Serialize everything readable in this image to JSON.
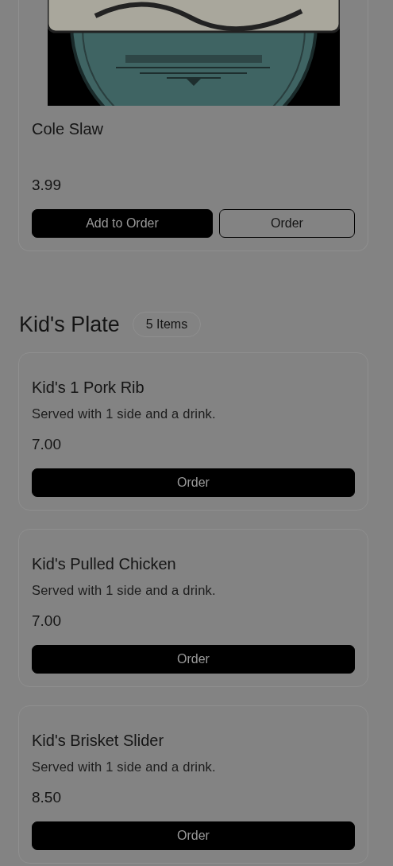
{
  "previous_item": {
    "name": "Cole Slaw",
    "price": "3.99",
    "buttons": [
      {
        "label": "Add to Order",
        "kind": "filled"
      },
      {
        "label": "Order",
        "kind": "outline"
      }
    ]
  },
  "section": {
    "title": "Kid's Plate",
    "count": "5 Items",
    "items": [
      {
        "name": "Kid's 1 Pork Rib",
        "description": "Served with 1 side and a drink.",
        "price": "7.00",
        "buttons": [
          {
            "label": "Order",
            "kind": "filled"
          }
        ]
      },
      {
        "name": "Kid's Pulled Chicken",
        "description": "Served with 1 side and a drink.",
        "price": "7.00",
        "buttons": [
          {
            "label": "Order",
            "kind": "filled"
          }
        ]
      },
      {
        "name": "Kid's Brisket Slider",
        "description": "Served with 1 side and a drink.",
        "price": "8.50",
        "buttons": [
          {
            "label": "Order",
            "kind": "filled"
          }
        ]
      }
    ]
  }
}
